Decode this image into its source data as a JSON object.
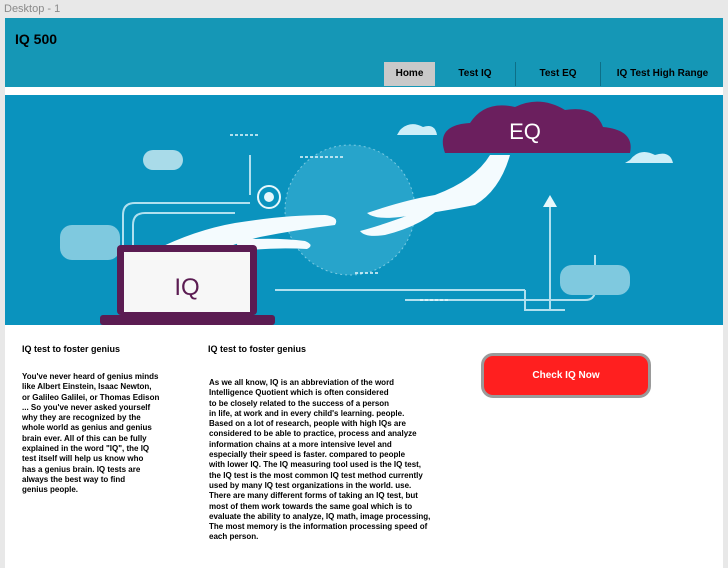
{
  "window": {
    "title": "Desktop - 1"
  },
  "header": {
    "brand": "IQ 500"
  },
  "nav": {
    "items": [
      "Home",
      "Test IQ",
      "Test EQ",
      "IQ Test High Range"
    ]
  },
  "hero": {
    "cloud_label": "EQ",
    "laptop_label": "IQ"
  },
  "left_column": {
    "title": "IQ test to foster genius",
    "body": "You've never heard of genius minds\nlike Albert Einstein, Isaac Newton,\nor Galileo Galilei, or Thomas Edison\n ... So you've never asked yourself\nwhy they are recognized by the\nwhole world as genius and genius\nbrain ever. All of this can be fully\nexplained in the word \"IQ\", the IQ\ntest itself will help us know who\nhas a genius brain. IQ tests are\nalways the best way to find\ngenius people."
  },
  "middle_column": {
    "title": "IQ test to foster genius",
    "body": "As we all know, IQ is an abbreviation of the word\nIntelligence Quotient which is often considered\nto be closely related to the success of a person\nin life, at work and in every child's learning. people.\nBased on a lot of research, people with high IQs are\nconsidered to be able to practice, process and analyze\ninformation chains at a more intensive level and\nespecially their speed is faster. compared to people\nwith lower IQ. The IQ measuring tool used is the IQ test,\nthe IQ test is the most common IQ test method currently\nused by many IQ test organizations in the world. use.\nThere are many different forms of taking an IQ test, but\nmost of them work towards the same goal which is to\nevaluate the ability to analyze, IQ math, image processing,\nThe most memory is the information processing speed of\neach person."
  },
  "cta": {
    "label": "Check IQ Now"
  },
  "colors": {
    "header": "#1597b6",
    "hero": "#0a93be",
    "cta": "#ff1f1f",
    "cloud": "#6b1f5e"
  }
}
